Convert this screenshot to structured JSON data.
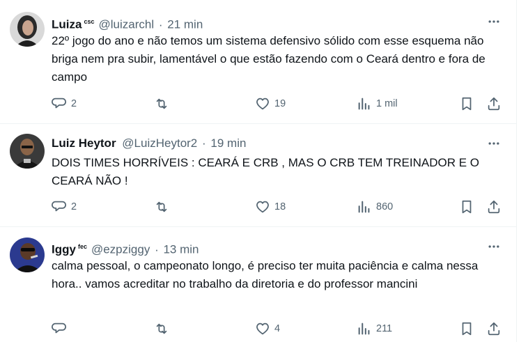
{
  "tweets": [
    {
      "name": "Luiza",
      "badge": "csc",
      "handle": "@luizarchl",
      "time": "21 min",
      "text": "22º jogo do ano e não temos um sistema defensivo sólido com esse esquema não briga nem pra subir, lamentável o que estão fazendo com o Ceará dentro e fora de campo",
      "replies": "2",
      "reposts": "",
      "likes": "19",
      "views": "1 mil"
    },
    {
      "name": "Luiz Heytor",
      "badge": "",
      "handle": "@LuizHeytor2",
      "time": "19 min",
      "text": "DOIS TIMES HORRÍVEIS : CEARÁ E CRB , MAS O CRB TEM TREINADOR E O CEARÁ NÃO !",
      "replies": "2",
      "reposts": "",
      "likes": "18",
      "views": "860"
    },
    {
      "name": "Iggy",
      "badge": "fec",
      "handle": "@ezpziggy",
      "time": "13 min",
      "text": "calma pessoal, o campeonato longo, é preciso ter muita paciência e calma nessa hora.. vamos acreditar no trabalho da diretoria e do professor mancini",
      "replies": "",
      "reposts": "",
      "likes": "4",
      "views": "211"
    }
  ],
  "separator": "·",
  "icons": [
    "more-icon",
    "reply-icon",
    "repost-icon",
    "like-icon",
    "views-icon",
    "bookmark-icon",
    "share-icon"
  ],
  "colors": {
    "text": "#0f1419",
    "secondary": "#536471",
    "border": "#eff3f4"
  }
}
